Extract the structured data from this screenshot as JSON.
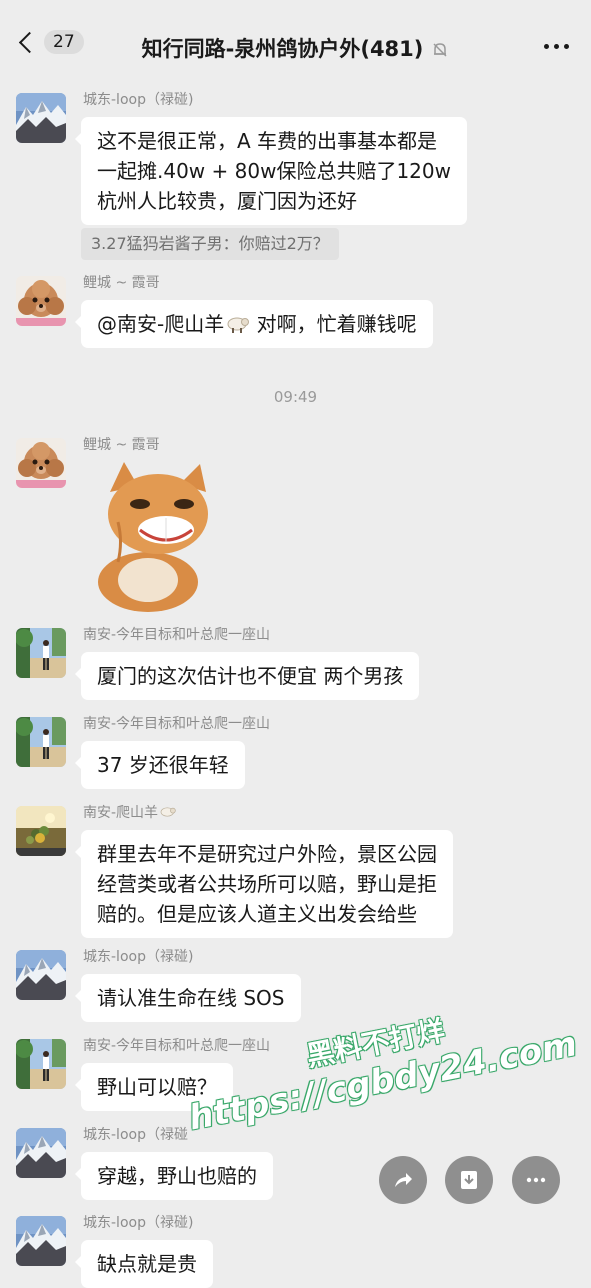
{
  "header": {
    "back_count": "27",
    "title": "知行同路-泉州鸽协户外(481)",
    "icons": [
      "back-chevron-icon",
      "mute-bell-icon",
      "more-icon"
    ]
  },
  "messages": [
    {
      "sender": "城东-loop（禄碰)",
      "avatar": "snow-mountain",
      "text_lines": [
        "这不是很正常，A 车费的出事基本都是",
        "一起摊.40w + 80w保险总共赔了120w",
        "杭州人比较贵，厦门因为还好"
      ],
      "quote": "3.27猛犸岩酱子男：你赔过2万？"
    },
    {
      "sender": "鲤城 ~ 霞哥",
      "avatar": "poodle",
      "text_before_icon": "@南安-爬山羊",
      "text_after_icon": " 对啊，忙着赚钱呢"
    }
  ],
  "time_divider": "09:49",
  "later_messages": [
    {
      "sender": "鲤城 ~ 霞哥",
      "avatar": "poodle",
      "sticker": "grinning-cat"
    },
    {
      "sender": "南安-今年目标和叶总爬一座山",
      "avatar": "hiker",
      "text_lines": [
        "厦门的这次估计也不便宜 两个男孩"
      ]
    },
    {
      "sender": "南安-今年目标和叶总爬一座山",
      "avatar": "hiker",
      "text_lines": [
        "37 岁还很年轻"
      ]
    },
    {
      "sender": "南安-爬山羊",
      "avatar": "sunset-plants",
      "text_lines": [
        "群里去年不是研究过户外险，景区公园",
        "经营类或者公共场所可以赔，野山是拒",
        "赔的。但是应该人道主义出发会给些"
      ]
    },
    {
      "sender": "城东-loop（禄碰)",
      "avatar": "snow-mountain",
      "text_lines": [
        "请认准生命在线 SOS"
      ]
    },
    {
      "sender": "南安-今年目标和叶总爬一座山",
      "avatar": "hiker",
      "text_lines": [
        "野山可以赔？"
      ]
    },
    {
      "sender": "城东-loop（禄碰",
      "avatar": "snow-mountain",
      "text_lines": [
        "穿越，野山也赔的"
      ]
    },
    {
      "sender": "城东-loop（禄碰)",
      "avatar": "snow-mountain",
      "text_lines": [
        "缺点就是贵"
      ]
    }
  ],
  "actions": [
    "share-icon",
    "save-icon",
    "more-icon"
  ],
  "watermark": {
    "line1": "黑料不打烊",
    "line2": "https://cgbdy24.com"
  }
}
